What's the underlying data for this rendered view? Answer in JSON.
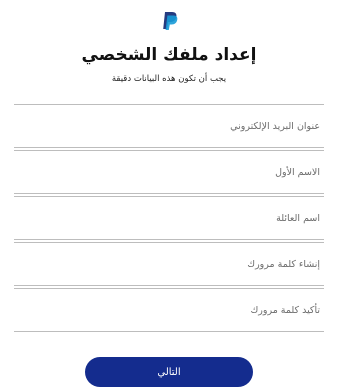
{
  "brand": {
    "logo_icon": "paypal-logo-icon",
    "colors": {
      "primary": "#142c8e",
      "logo_dark": "#253b80",
      "logo_light": "#179bd7"
    }
  },
  "header": {
    "title": "إعداد ملفك الشخصي",
    "subtitle": "يجب أن تكون هذه البيانات دقيقة"
  },
  "form": {
    "fields": [
      {
        "label": "عنوان البريد الإلكتروني",
        "value": ""
      },
      {
        "label": "الاسم الأول",
        "value": ""
      },
      {
        "label": "اسم العائلة",
        "value": ""
      },
      {
        "label": "إنشاء كلمة مرورك",
        "value": ""
      },
      {
        "label": "تأكيد كلمة مرورك",
        "value": ""
      }
    ],
    "next_label": "التالي"
  }
}
